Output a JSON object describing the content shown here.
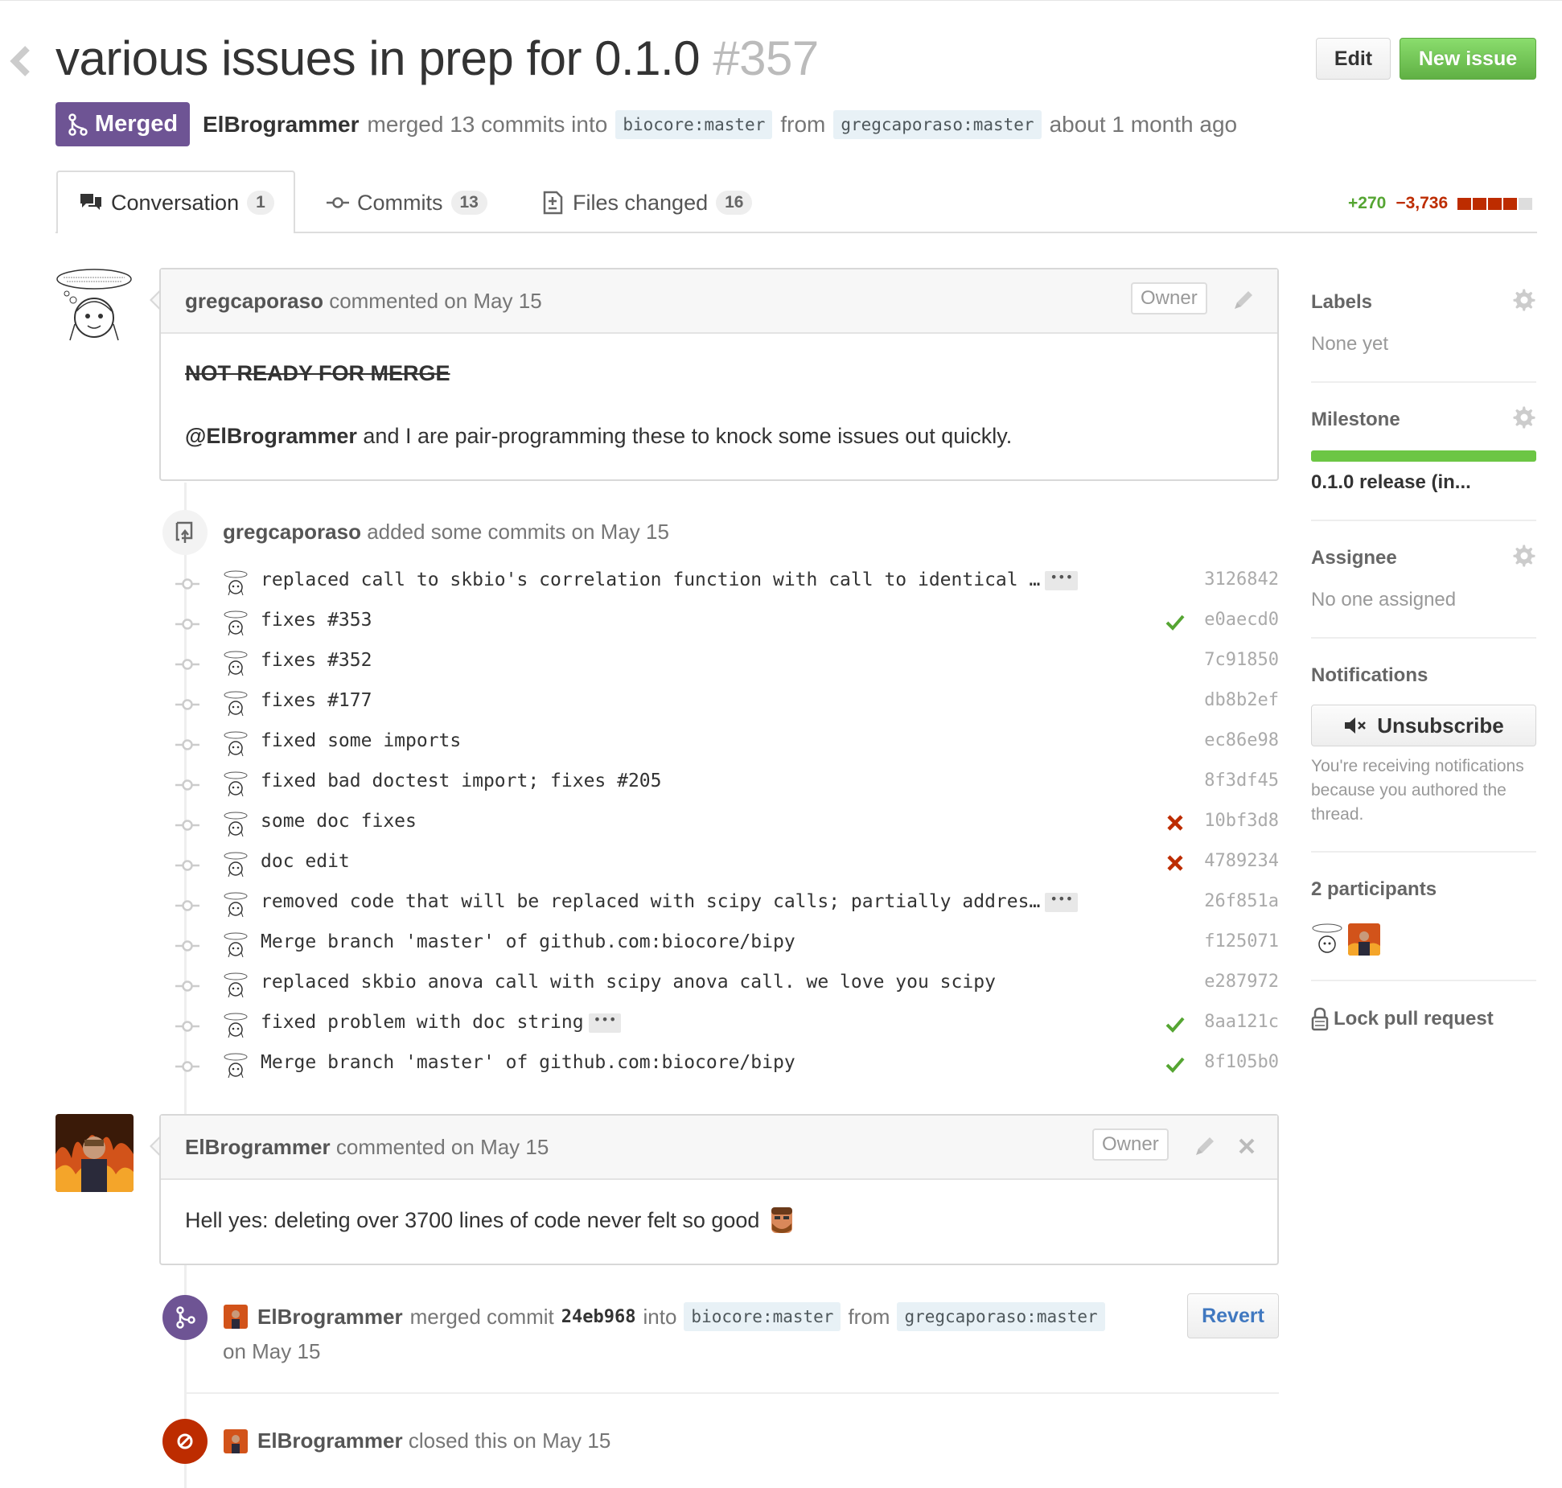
{
  "header": {
    "title": "various issues in prep for 0.1.0",
    "number": "#357",
    "edit_label": "Edit",
    "new_issue_label": "New issue"
  },
  "state": {
    "badge": "Merged",
    "author": "ElBrogrammer",
    "merged_text": "merged 13 commits into",
    "base_branch_owner": "biocore",
    "base_branch_name": "master",
    "from_text": "from",
    "head_branch_owner": "gregcaporaso",
    "head_branch_name": "master",
    "time": "about 1 month ago"
  },
  "tabs": [
    {
      "label": "Conversation",
      "count": "1"
    },
    {
      "label": "Commits",
      "count": "13"
    },
    {
      "label": "Files changed",
      "count": "16"
    }
  ],
  "diffstat": {
    "additions": "+270",
    "deletions": "−3,736",
    "blocks": [
      "del",
      "del",
      "del",
      "del",
      "gray"
    ]
  },
  "first_comment": {
    "author": "gregcaporaso",
    "action": "commented on May 15",
    "owner_label": "Owner",
    "strike_text": "NOT READY FOR MERGE",
    "mention": "@ElBrogrammer",
    "body": "and I are pair-programming these to knock some issues out quickly."
  },
  "commits_event": {
    "author": "gregcaporaso",
    "action": "added some commits on May 15"
  },
  "commits": [
    {
      "message": "replaced call to skbio's correlation function with call to identical …",
      "ellipsis": "•••",
      "sha": "3126842",
      "status": "none"
    },
    {
      "message": "fixes #353",
      "ellipsis": "",
      "sha": "e0aecd0",
      "status": "success"
    },
    {
      "message": "fixes #352",
      "ellipsis": "",
      "sha": "7c91850",
      "status": "none"
    },
    {
      "message": "fixes #177",
      "ellipsis": "",
      "sha": "db8b2ef",
      "status": "none"
    },
    {
      "message": "fixed some imports",
      "ellipsis": "",
      "sha": "ec86e98",
      "status": "none"
    },
    {
      "message": "fixed bad doctest import; fixes #205",
      "ellipsis": "",
      "sha": "8f3df45",
      "status": "none"
    },
    {
      "message": "some doc fixes",
      "ellipsis": "",
      "sha": "10bf3d8",
      "status": "failure"
    },
    {
      "message": "doc edit",
      "ellipsis": "",
      "sha": "4789234",
      "status": "failure"
    },
    {
      "message": "removed code that will be replaced with scipy calls; partially addres…",
      "ellipsis": "•••",
      "sha": "26f851a",
      "status": "none"
    },
    {
      "message": "Merge branch 'master' of github.com:biocore/bipy",
      "ellipsis": "",
      "sha": "f125071",
      "status": "none"
    },
    {
      "message": "replaced skbio anova call with scipy anova call. we love you scipy",
      "ellipsis": "",
      "sha": "e287972",
      "status": "none"
    },
    {
      "message": "fixed problem with doc string",
      "ellipsis": "•••",
      "sha": "8aa121c",
      "status": "success"
    },
    {
      "message": "Merge branch 'master' of github.com:biocore/bipy",
      "ellipsis": "",
      "sha": "8f105b0",
      "status": "success"
    }
  ],
  "second_comment": {
    "author": "ElBrogrammer",
    "action": "commented on May 15",
    "owner_label": "Owner",
    "body": "Hell yes: deleting over 3700 lines of code never felt so good"
  },
  "merge_event": {
    "author": "ElBrogrammer",
    "text": "merged commit",
    "sha": "24eb968",
    "into": "into",
    "base_owner": "biocore",
    "base_name": "master",
    "from": "from",
    "head_owner": "gregcaporaso",
    "head_name": "master",
    "date": "on May 15",
    "revert_label": "Revert"
  },
  "close_event": {
    "author": "ElBrogrammer",
    "text": "closed this on May 15"
  },
  "sidebar": {
    "labels_title": "Labels",
    "labels_value": "None yet",
    "milestone_title": "Milestone",
    "milestone_progress": 1.0,
    "milestone_value": "0.1.0 release (in...",
    "assignee_title": "Assignee",
    "assignee_value": "No one assigned",
    "notifications_title": "Notifications",
    "unsubscribe_label": "Unsubscribe",
    "notifications_reason": "You're receiving notifications because you authored the thread.",
    "participants_title": "2 participants",
    "lock_label": "Lock pull request"
  },
  "colors": {
    "merged_purple": "#6e5494",
    "new_issue_green": "#60b044",
    "success_green": "#55a532",
    "failure_red": "#bd2c00",
    "link_blue": "#4078c0"
  }
}
